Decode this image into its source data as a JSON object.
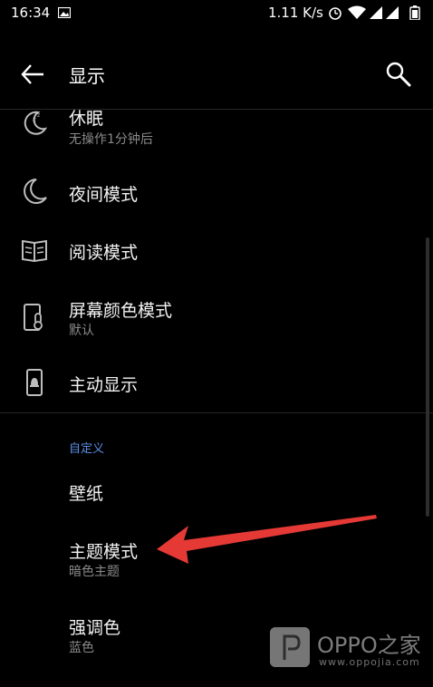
{
  "status_bar": {
    "time": "16:34",
    "net_speed": "1.11 K/s",
    "icons": [
      "image-icon",
      "alarm-icon",
      "wifi-icon",
      "signal-icon",
      "signal-icon",
      "battery-icon"
    ]
  },
  "header": {
    "title": "显示",
    "back_icon": "back-arrow-icon",
    "search_icon": "search-icon"
  },
  "settings": [
    {
      "id": "sleep",
      "title": "休眠",
      "subtitle": "无操作1分钟后",
      "icon": "sleep-icon"
    },
    {
      "id": "night-mode",
      "title": "夜间模式",
      "icon": "moon-icon"
    },
    {
      "id": "reading-mode",
      "title": "阅读模式",
      "icon": "book-icon"
    },
    {
      "id": "screen-color-mode",
      "title": "屏幕颜色模式",
      "subtitle": "默认",
      "icon": "screen-thermometer-icon"
    },
    {
      "id": "active-display",
      "title": "主动显示",
      "icon": "phone-bell-icon"
    }
  ],
  "custom_section": {
    "title": "自定义",
    "items": [
      {
        "id": "wallpaper",
        "title": "壁纸"
      },
      {
        "id": "theme-mode",
        "title": "主题模式",
        "subtitle": "暗色主题"
      },
      {
        "id": "accent-color",
        "title": "强调色",
        "subtitle": "蓝色"
      }
    ]
  },
  "annotation": {
    "type": "red-arrow",
    "target": "theme-mode",
    "color": "#e53935"
  },
  "watermark": {
    "title": "OPPO之家",
    "url": "www.oppojia.com"
  },
  "colors": {
    "background": "#000000",
    "accent": "#5b8fe6",
    "secondary_text": "#8a8a8a"
  }
}
